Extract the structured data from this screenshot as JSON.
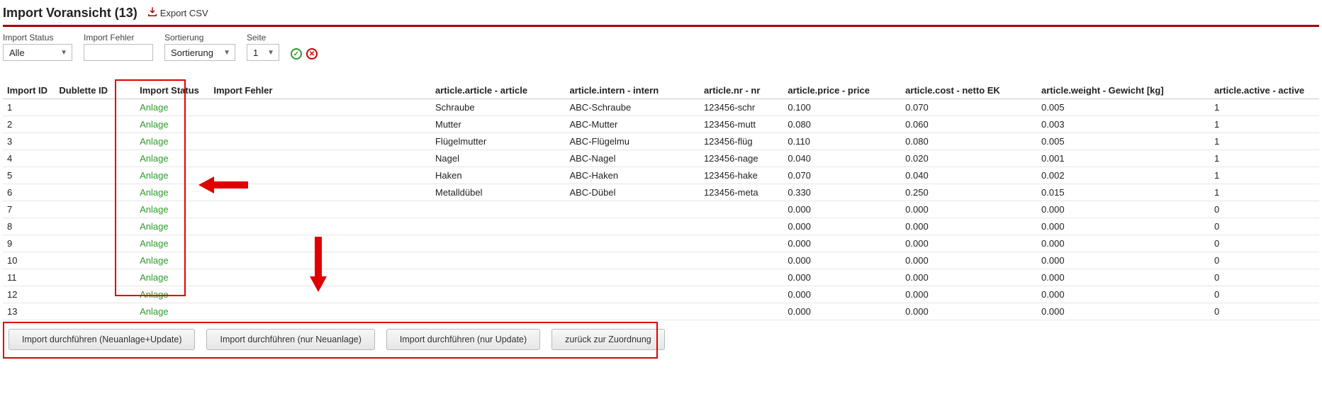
{
  "header": {
    "title": "Import Voransicht (13)",
    "export_label": "Export CSV"
  },
  "filters": {
    "status_label": "Import Status",
    "status_value": "Alle",
    "fehler_label": "Import Fehler",
    "fehler_value": "",
    "sort_label": "Sortierung",
    "sort_value": "Sortierung",
    "page_label": "Seite",
    "page_value": "1"
  },
  "columns": {
    "id": "Import ID",
    "dublette": "Dublette ID",
    "status": "Import Status",
    "fehler": "Import Fehler",
    "article": "article.article - article",
    "intern": "article.intern - intern",
    "nr": "article.nr - nr",
    "price": "article.price - price",
    "cost": "article.cost - netto EK",
    "weight": "article.weight - Gewicht [kg]",
    "active": "article.active - active"
  },
  "rows": [
    {
      "id": "1",
      "status": "Anlage",
      "article": "Schraube",
      "intern": "ABC-Schraube",
      "nr": "123456-schr",
      "price": "0.100",
      "cost": "0.070",
      "weight": "0.005",
      "active": "1"
    },
    {
      "id": "2",
      "status": "Anlage",
      "article": "Mutter",
      "intern": "ABC-Mutter",
      "nr": "123456-mutt",
      "price": "0.080",
      "cost": "0.060",
      "weight": "0.003",
      "active": "1"
    },
    {
      "id": "3",
      "status": "Anlage",
      "article": "Flügelmutter",
      "intern": "ABC-Flügelmu",
      "nr": "123456-flüg",
      "price": "0.110",
      "cost": "0.080",
      "weight": "0.005",
      "active": "1"
    },
    {
      "id": "4",
      "status": "Anlage",
      "article": "Nagel",
      "intern": "ABC-Nagel",
      "nr": "123456-nage",
      "price": "0.040",
      "cost": "0.020",
      "weight": "0.001",
      "active": "1"
    },
    {
      "id": "5",
      "status": "Anlage",
      "article": "Haken",
      "intern": "ABC-Haken",
      "nr": "123456-hake",
      "price": "0.070",
      "cost": "0.040",
      "weight": "0.002",
      "active": "1"
    },
    {
      "id": "6",
      "status": "Anlage",
      "article": "Metalldübel",
      "intern": "ABC-Dübel",
      "nr": "123456-meta",
      "price": "0.330",
      "cost": "0.250",
      "weight": "0.015",
      "active": "1"
    },
    {
      "id": "7",
      "status": "Anlage",
      "article": "",
      "intern": "",
      "nr": "",
      "price": "0.000",
      "cost": "0.000",
      "weight": "0.000",
      "active": "0"
    },
    {
      "id": "8",
      "status": "Anlage",
      "article": "",
      "intern": "",
      "nr": "",
      "price": "0.000",
      "cost": "0.000",
      "weight": "0.000",
      "active": "0"
    },
    {
      "id": "9",
      "status": "Anlage",
      "article": "",
      "intern": "",
      "nr": "",
      "price": "0.000",
      "cost": "0.000",
      "weight": "0.000",
      "active": "0"
    },
    {
      "id": "10",
      "status": "Anlage",
      "article": "",
      "intern": "",
      "nr": "",
      "price": "0.000",
      "cost": "0.000",
      "weight": "0.000",
      "active": "0"
    },
    {
      "id": "11",
      "status": "Anlage",
      "article": "",
      "intern": "",
      "nr": "",
      "price": "0.000",
      "cost": "0.000",
      "weight": "0.000",
      "active": "0"
    },
    {
      "id": "12",
      "status": "Anlage",
      "article": "",
      "intern": "",
      "nr": "",
      "price": "0.000",
      "cost": "0.000",
      "weight": "0.000",
      "active": "0"
    },
    {
      "id": "13",
      "status": "Anlage",
      "article": "",
      "intern": "",
      "nr": "",
      "price": "0.000",
      "cost": "0.000",
      "weight": "0.000",
      "active": "0"
    }
  ],
  "buttons": {
    "b1": "Import durchführen (Neuanlage+Update)",
    "b2": "Import durchführen (nur Neuanlage)",
    "b3": "Import durchführen (nur Update)",
    "b4": "zurück zur Zuordnung"
  }
}
